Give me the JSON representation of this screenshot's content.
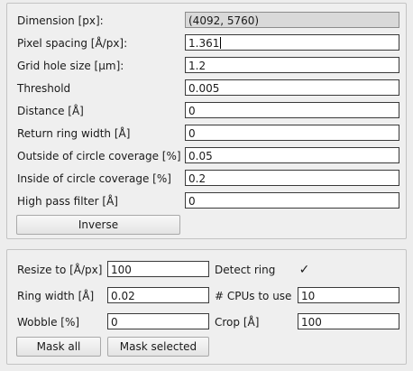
{
  "params": {
    "dimension": {
      "label": "Dimension [px]:",
      "value": "(4092, 5760)"
    },
    "pixel_spacing": {
      "label": "Pixel spacing [Å/px]:",
      "value": "1.361"
    },
    "grid_hole_size": {
      "label": "Grid hole size [µm]:",
      "value": "1.2"
    },
    "threshold": {
      "label": "Threshold",
      "value": "0.005"
    },
    "distance": {
      "label": "Distance [Å]",
      "value": "0"
    },
    "return_ring_width": {
      "label": "Return ring width [Å]",
      "value": "0"
    },
    "outside_coverage": {
      "label": "Outside of circle coverage [%]",
      "value": "0.05"
    },
    "inside_coverage": {
      "label": "Inside of circle coverage [%]",
      "value": "0.2"
    },
    "high_pass": {
      "label": "High pass filter [Å]",
      "value": "0"
    },
    "inverse_label": "Inverse"
  },
  "mask": {
    "resize_to": {
      "label": "Resize to [Å/px]",
      "value": "100"
    },
    "detect_ring": {
      "label": "Detect ring",
      "checked": true
    },
    "ring_width": {
      "label": "Ring width [Å]",
      "value": "0.02"
    },
    "cpus": {
      "label": "# CPUs to use",
      "value": "10"
    },
    "wobble": {
      "label": "Wobble [%]",
      "value": "0"
    },
    "crop": {
      "label": "Crop [Å]",
      "value": "100"
    },
    "mask_all_label": "Mask all",
    "mask_selected_label": "Mask selected"
  }
}
